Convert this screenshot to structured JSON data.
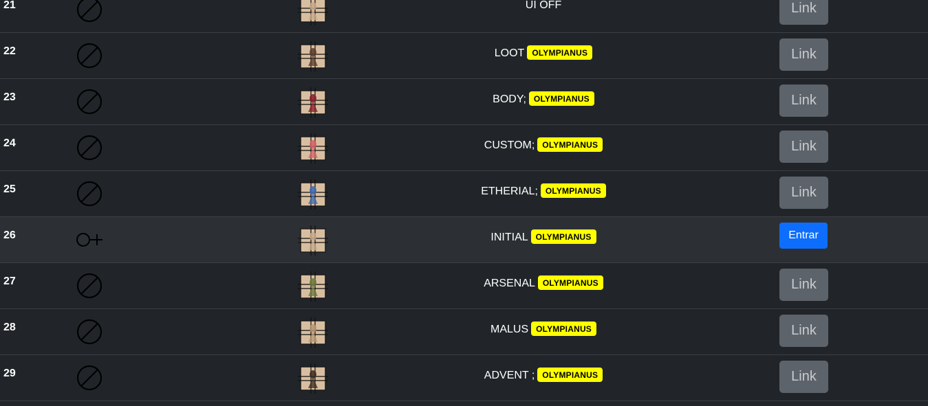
{
  "rows": [
    {
      "num": "21",
      "icon": "prohibited-icon",
      "name": "UI OFF",
      "badge": "",
      "action": "Link",
      "active": false,
      "thumb_color": "#c9a98a"
    },
    {
      "num": "22",
      "icon": "prohibited-icon",
      "name": "LOOT",
      "badge": "OLYMPIANUS",
      "action": "Link",
      "active": false,
      "thumb_color": "#5a3a28"
    },
    {
      "num": "23",
      "icon": "prohibited-icon",
      "name": "BODY;",
      "badge": "OLYMPIANUS",
      "action": "Link",
      "active": false,
      "thumb_color": "#8a1a28"
    },
    {
      "num": "24",
      "icon": "prohibited-icon",
      "name": "CUSTOM;",
      "badge": "OLYMPIANUS",
      "action": "Link",
      "active": false,
      "thumb_color": "#d9606a"
    },
    {
      "num": "25",
      "icon": "prohibited-icon",
      "name": "ETHERIAL;",
      "badge": "OLYMPIANUS",
      "action": "Link",
      "active": false,
      "thumb_color": "#3a6ab8"
    },
    {
      "num": "26",
      "icon": "venus-key-icon",
      "name": "INITIAL",
      "badge": "OLYMPIANUS",
      "action": "Entrar",
      "active": true,
      "thumb_color": "#c9a98a"
    },
    {
      "num": "27",
      "icon": "prohibited-icon",
      "name": "ARSENAL",
      "badge": "OLYMPIANUS",
      "action": "Link",
      "active": false,
      "thumb_color": "#6a7a3a"
    },
    {
      "num": "28",
      "icon": "prohibited-icon",
      "name": "MALUS",
      "badge": "OLYMPIANUS",
      "action": "Link",
      "active": false,
      "thumb_color": "#b89870"
    },
    {
      "num": "29",
      "icon": "prohibited-icon",
      "name": "ADVENT ;",
      "badge": "OLYMPIANUS",
      "action": "Link",
      "active": false,
      "thumb_color": "#3a2a20"
    }
  ]
}
